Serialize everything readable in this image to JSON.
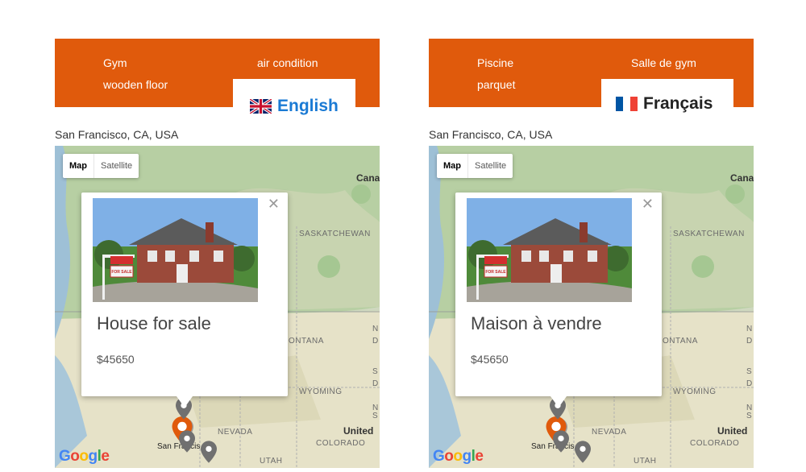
{
  "panels": [
    {
      "features": [
        "Gym",
        "air condition",
        "wooden floor"
      ],
      "language": "English",
      "address": "San Francisco, CA, USA",
      "map_type": {
        "map": "Map",
        "satellite": "Satellite"
      },
      "popup": {
        "title": "House for sale",
        "price": "$45650",
        "sign": "FOR SALE"
      },
      "map_labels": {
        "canada": "Cana",
        "saskatchewan": "SASKATCHEWAN",
        "montana": "ONTANA",
        "wyoming": "WYOMING",
        "nevada": "NEVADA",
        "utah": "UTAH",
        "colorado": "COLORADO",
        "united": "United",
        "sf": "San Francis",
        "n": "N",
        "d": "D",
        "s": "S",
        "n2": "N",
        "d2": "D",
        "s2": "S",
        "d3": "D",
        "k": "K"
      },
      "google": [
        "G",
        "o",
        "o",
        "g",
        "l",
        "e"
      ]
    },
    {
      "features": [
        "Piscine",
        "Salle de gym",
        "parquet"
      ],
      "language": "Français",
      "address": "San Francisco, CA, USA",
      "map_type": {
        "map": "Map",
        "satellite": "Satellite"
      },
      "popup": {
        "title": "Maison à vendre",
        "price": "$45650",
        "sign": "FOR SALE"
      },
      "map_labels": {
        "canada": "Cana",
        "saskatchewan": "SASKATCHEWAN",
        "montana": "ONTANA",
        "wyoming": "WYOMING",
        "nevada": "NEVADA",
        "utah": "UTAH",
        "colorado": "COLORADO",
        "united": "United",
        "sf": "San Francis",
        "n": "N",
        "d": "D",
        "s": "S",
        "n2": "N",
        "d2": "D",
        "s2": "S",
        "d3": "D",
        "k": "K"
      },
      "google": [
        "G",
        "o",
        "o",
        "g",
        "l",
        "e"
      ]
    }
  ],
  "colors": {
    "feature_bar": "#e05a0c",
    "english_link": "#1a7ad4",
    "marker_orange": "#e05a0c",
    "marker_gray": "#777777"
  },
  "icons": {
    "uk_flag": "uk-flag-icon",
    "fr_flag": "france-flag-icon",
    "close": "close-icon",
    "marker": "map-marker-icon"
  }
}
